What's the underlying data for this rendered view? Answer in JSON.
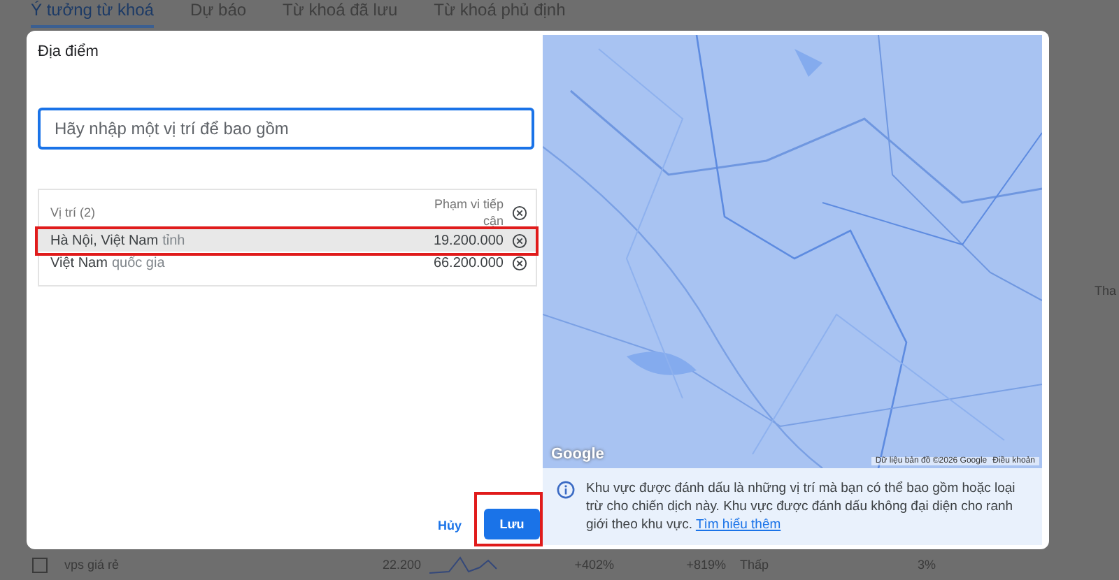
{
  "tabs": [
    {
      "label": "Ý tưởng từ khoá",
      "selected": true
    },
    {
      "label": "Dự báo",
      "selected": false
    },
    {
      "label": "Từ khoá đã lưu",
      "selected": false
    },
    {
      "label": "Từ khoá phủ định",
      "selected": false
    }
  ],
  "dialog": {
    "title": "Địa điểm",
    "search": {
      "placeholder": "Hãy nhập một vị trí để bao gồm"
    },
    "locations_table": {
      "header_location": "Vị trí (2)",
      "header_reach": "Phạm vi tiếp cận",
      "rows": [
        {
          "name": "Hà Nội, Việt Nam",
          "type": "tỉnh",
          "reach": "19.200.000",
          "selected": true,
          "annotated": true
        },
        {
          "name": "Việt Nam",
          "type": "quốc gia",
          "reach": "66.200.000",
          "selected": false,
          "annotated": false
        }
      ]
    },
    "buttons": [
      {
        "label": "Hủy",
        "kind": "text",
        "annotated": false
      },
      {
        "label": "Lưu",
        "kind": "primary",
        "annotated": true
      }
    ],
    "map": {
      "kind": "picture",
      "logo": "Google",
      "attribution": "Dữ liệu bản đồ ©2026 Google",
      "terms": "Điều khoản"
    },
    "info": {
      "text": "Khu vực được đánh dấu là những vị trí mà bạn có thể bao gồm hoặc loại trừ cho chiến dịch này. Khu vực được đánh dấu không đại diện cho ranh giới theo khu vực.",
      "link": "Tìm hiểu thêm"
    }
  },
  "side_label": "Tha",
  "background_row": {
    "checked": false,
    "keyword": "vps giá rẻ",
    "searches": "22.200",
    "change_3m": "+402%",
    "change_yoy": "+819%",
    "competition": "Thấp",
    "impression_share": "3%"
  }
}
